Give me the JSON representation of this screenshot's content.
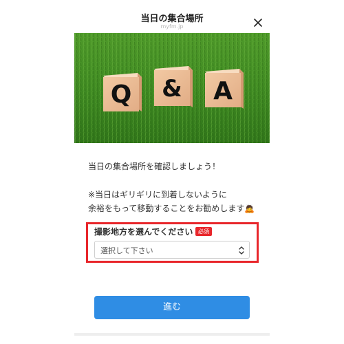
{
  "header": {
    "title": "当日の集合場所",
    "domain": "myfm.jp"
  },
  "hero": {
    "blocks": [
      "Q",
      "&",
      "A"
    ]
  },
  "content": {
    "line1": "当日の集合場所を確認しましょう！",
    "line2": "※当日はギリギリに到着しないように",
    "line3": "余裕をもって移動することをお勧めします🙇"
  },
  "form": {
    "label": "撮影地方を選んでください",
    "required": "必須",
    "select_value": "選択して下さい"
  },
  "submit_label": "進む",
  "colors": {
    "accent": "#2f8de4",
    "required": "#e8262b",
    "highlight": "#e8262b"
  }
}
